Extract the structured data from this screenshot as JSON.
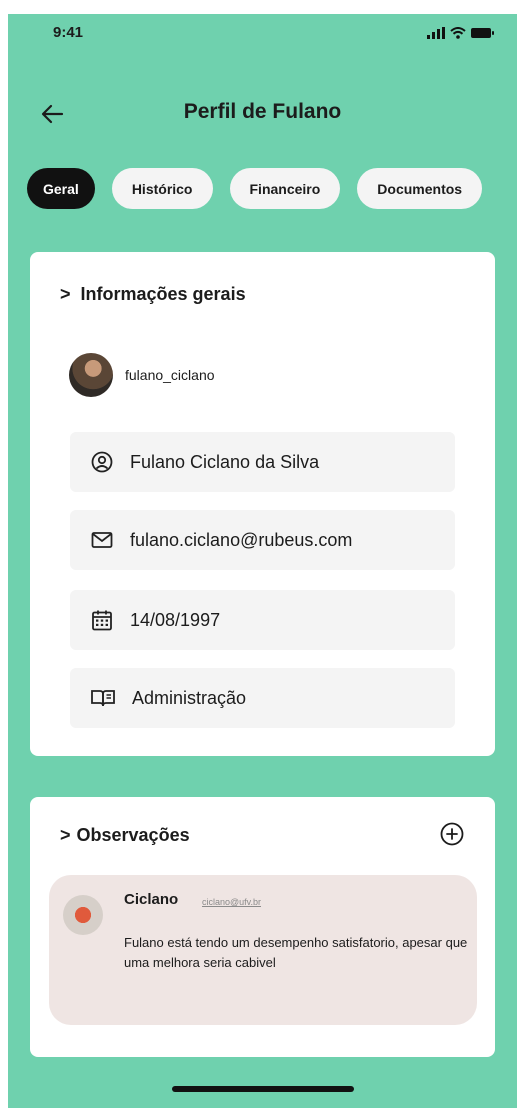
{
  "status_bar": {
    "time": "9:41"
  },
  "header": {
    "title": "Perfil de Fulano"
  },
  "tabs": [
    {
      "label": "Geral",
      "active": true
    },
    {
      "label": "Histórico",
      "active": false
    },
    {
      "label": "Financeiro",
      "active": false
    },
    {
      "label": "Documentos",
      "active": false
    }
  ],
  "info": {
    "section_title": "Informações gerais",
    "username": "fulano_ciclano",
    "name": "Fulano Ciclano da Silva",
    "email": "fulano.ciclano@rubeus.com",
    "birthdate": "14/08/1997",
    "course": "Administração"
  },
  "observations": {
    "section_title": "Observações",
    "items": [
      {
        "author": "Ciclano",
        "email": "ciclano@ufv.br",
        "text": "Fulano está tendo um desempenho satisfatorio, apesar que uma melhora seria cabivel"
      }
    ]
  },
  "colors": {
    "background": "#6fd1ae",
    "card": "#ffffff",
    "active_tab": "#111111",
    "comment_bg": "#efe5e3"
  }
}
